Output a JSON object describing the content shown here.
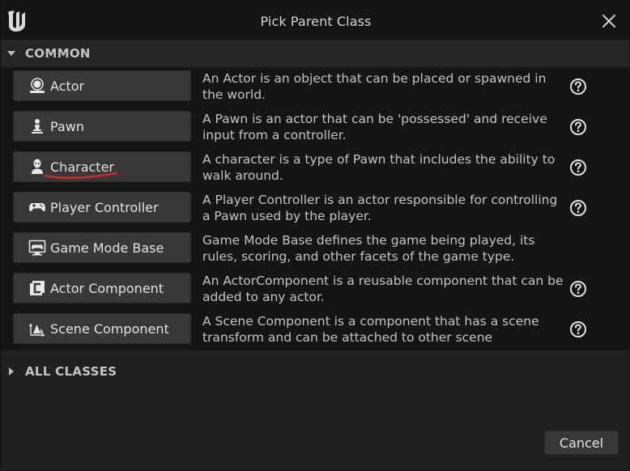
{
  "window": {
    "title": "Pick Parent Class"
  },
  "sections": {
    "common": {
      "label": "COMMON",
      "expanded": true
    },
    "all_classes": {
      "label": "ALL CLASSES",
      "expanded": false
    }
  },
  "classes": [
    {
      "name": "Actor",
      "icon": "actor-icon",
      "description": "An Actor is an object that can be placed or spawned in the world.",
      "has_help": true
    },
    {
      "name": "Pawn",
      "icon": "pawn-icon",
      "description": "A Pawn is an actor that can be 'possessed' and receive input from a controller.",
      "has_help": true
    },
    {
      "name": "Character",
      "icon": "character-icon",
      "description": "A character is a type of Pawn that includes the ability to walk around.",
      "has_help": true,
      "annotated": true
    },
    {
      "name": "Player Controller",
      "icon": "gamepad-icon",
      "description": "A Player Controller is an actor responsible for controlling a Pawn used by the player.",
      "has_help": true
    },
    {
      "name": "Game Mode Base",
      "icon": "game-mode-icon",
      "description": "Game Mode Base defines the game being played, its rules, scoring, and other facets of the game type.",
      "has_help": false
    },
    {
      "name": "Actor Component",
      "icon": "actor-component-icon",
      "description": "An ActorComponent is a reusable component that can be added to any actor.",
      "has_help": true
    },
    {
      "name": "Scene Component",
      "icon": "scene-component-icon",
      "description": "A Scene Component is a component that has a scene transform and can be attached to other scene",
      "has_help": true
    }
  ],
  "footer": {
    "cancel_label": "Cancel"
  },
  "colors": {
    "annotation": "#d8232a",
    "button_bg": "#383838",
    "panel_bg": "#151515"
  }
}
